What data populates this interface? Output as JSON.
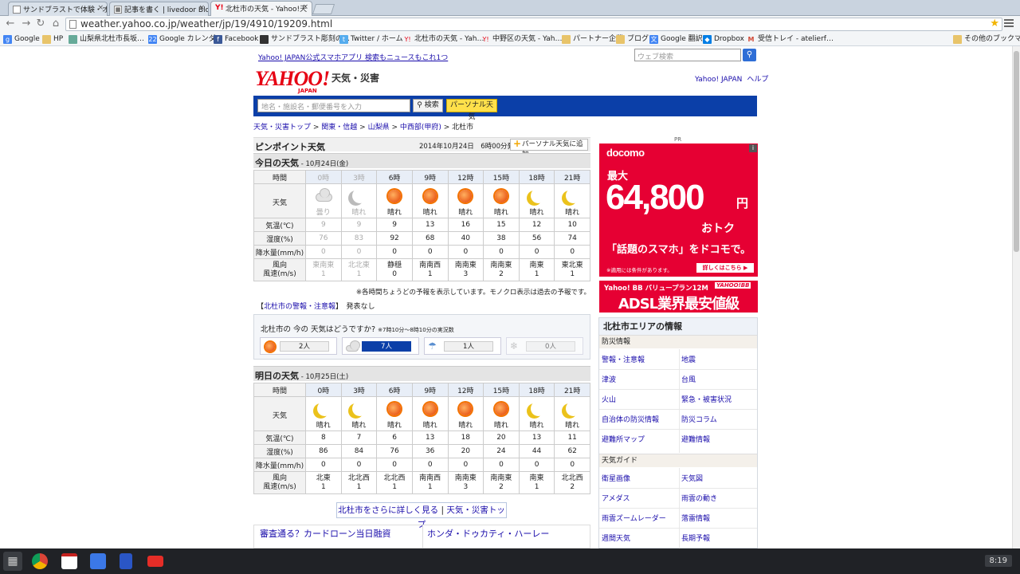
{
  "browser": {
    "tabs": [
      {
        "title": "サンドブラストで体験・オリジナ",
        "active": false
      },
      {
        "title": "記事を書く | livedoor Blog",
        "active": false
      },
      {
        "title": "北杜市の天気 - Yahoo!天",
        "active": true
      }
    ],
    "url": "weather.yahoo.co.jp/weather/jp/19/4910/19209.html",
    "bookmarks": [
      "Google",
      "HP",
      "山梨県北杜市長坂…",
      "Google カレンダー",
      "Facebook",
      "サンドブラスト彫刻の…",
      "Twitter / ホーム",
      "北杜市の天気 - Yah…",
      "中野区の天気 - Yah…",
      "パートナー企業",
      "ブログ",
      "Google 翻訳",
      "Dropbox",
      "受信トレイ - atelierf…",
      "その他のブックマーク"
    ]
  },
  "header": {
    "promo": "Yahoo! JAPAN公式スマホアプリ 検索もニュースもこれ1つ",
    "web_search_placeholder": "ウェブ検索",
    "logo": "YAHOO!",
    "logo_jp": "JAPAN",
    "logo_sub": "天気・災害",
    "links": [
      "Yahoo! JAPAN",
      "ヘルプ"
    ],
    "search_placeholder": "地名・施設名・郵便番号を入力",
    "search_btn": "検索",
    "personal_btn": "パーソナル天気"
  },
  "breadcrumb": [
    "天気・災害トップ",
    "関東・信越",
    "山梨県",
    "中西部(甲府)",
    "北杜市"
  ],
  "pinpoint": {
    "title": "ピンポイント天気",
    "date": "2014年10月24日　6時00分発表",
    "add": "パーソナル天気に追加"
  },
  "labels": {
    "time": "時間",
    "weather": "天気",
    "temp": "気温(℃)",
    "humid": "湿度(%)",
    "rain": "降水量(mm/h)",
    "wind1": "風向",
    "wind2": "風速(m/s)"
  },
  "today": {
    "title": "今日の天気",
    "date": " - 10月24日(金)",
    "times": [
      "0時",
      "3時",
      "6時",
      "9時",
      "12時",
      "15時",
      "18時",
      "21時"
    ],
    "past": [
      true,
      true,
      false,
      false,
      false,
      false,
      false,
      false
    ],
    "icons": [
      "cloudy-icon",
      "moon-icon",
      "sun-icon",
      "sun-icon",
      "sun-icon",
      "sun-icon",
      "moon-icon",
      "moon-icon"
    ],
    "weather": [
      "曇り",
      "晴れ",
      "晴れ",
      "晴れ",
      "晴れ",
      "晴れ",
      "晴れ",
      "晴れ"
    ],
    "temp": [
      "9",
      "9",
      "9",
      "13",
      "16",
      "15",
      "12",
      "10"
    ],
    "humid": [
      "76",
      "83",
      "92",
      "68",
      "40",
      "38",
      "56",
      "74"
    ],
    "rain": [
      "0",
      "0",
      "0",
      "0",
      "0",
      "0",
      "0",
      "0"
    ],
    "wind_dir": [
      "東南東",
      "北北東",
      "静穏",
      "南南西",
      "南南東",
      "南南東",
      "南東",
      "東北東"
    ],
    "wind_spd": [
      "1",
      "1",
      "0",
      "1",
      "3",
      "2",
      "1",
      "1"
    ]
  },
  "note": "※各時間ちょうどの予報を表示しています。モノクロ表示は過去の予報です。",
  "warn": {
    "link": "北杜市の警報・注意報",
    "status": "発表なし"
  },
  "poll": {
    "q": "北杜市の 今の 天気はどうですか?",
    "sub": "※7時10分～8時10分の実況数",
    "counts": [
      "2人",
      "7人",
      "1人",
      "0人"
    ]
  },
  "tomorrow": {
    "title": "明日の天気",
    "date": " - 10月25日(土)",
    "times": [
      "0時",
      "3時",
      "6時",
      "9時",
      "12時",
      "15時",
      "18時",
      "21時"
    ],
    "icons": [
      "moon-icon",
      "moon-icon",
      "sun-icon",
      "sun-icon",
      "sun-icon",
      "sun-icon",
      "moon-icon",
      "moon-icon"
    ],
    "weather": [
      "晴れ",
      "晴れ",
      "晴れ",
      "晴れ",
      "晴れ",
      "晴れ",
      "晴れ",
      "晴れ"
    ],
    "temp": [
      "8",
      "7",
      "6",
      "13",
      "18",
      "20",
      "13",
      "11"
    ],
    "humid": [
      "86",
      "84",
      "76",
      "36",
      "20",
      "24",
      "44",
      "62"
    ],
    "rain": [
      "0",
      "0",
      "0",
      "0",
      "0",
      "0",
      "0",
      "0"
    ],
    "wind_dir": [
      "北東",
      "北北西",
      "北北西",
      "南南西",
      "南南東",
      "南南東",
      "南東",
      "北北西"
    ],
    "wind_spd": [
      "1",
      "1",
      "1",
      "1",
      "3",
      "2",
      "1",
      "2"
    ]
  },
  "more": {
    "a": "北杜市をさらに詳しく見る",
    "b": "天気・災害トップ"
  },
  "ads": [
    "審査通る？カードローン当日融資",
    "ホンダ・ドゥカティ・ハーレー"
  ],
  "right": {
    "pr": "PR",
    "docomo": {
      "brand": "docomo",
      "max": "最大",
      "amount": "64,800",
      "yen": "円",
      "otoku": "おトク",
      "tag": "「話題のスマホ」をドコモで。",
      "cond": "※適用には条件があります。",
      "detail": "詳しくはこちら ▶"
    },
    "ybb": {
      "a": "Yahoo! BB バリュープラン12M",
      "b": "ADSL業界最安値級",
      "logo": "YAHOO!BB"
    },
    "area": {
      "title": "北杜市エリアの情報",
      "s1": "防災情報",
      "s1_links": [
        "警報・注意報",
        "地震",
        "津波",
        "台風",
        "火山",
        "緊急・被害状況",
        "自治体の防災情報",
        "防災コラム",
        "避難所マップ",
        "避難情報"
      ],
      "s2": "天気ガイド",
      "s2_links": [
        "衛星画像",
        "天気図",
        "アメダス",
        "雨雲の動き",
        "雨雲ズームレーダー",
        "落雷情報",
        "週間天気",
        "長期予報"
      ]
    }
  },
  "taskbar": {
    "time": "8:19",
    "colors": {
      "chrome": "#db4437",
      "gmail": "#c5221f",
      "gplus": "#3b78e7",
      "docs": "#2a56c6",
      "youtube": "#e52d27"
    }
  }
}
